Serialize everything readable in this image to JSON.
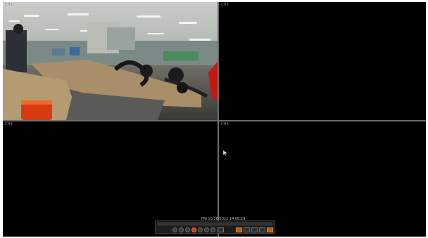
{
  "viewer": {
    "channels": [
      {
        "label": "CH1"
      },
      {
        "label": "CH2"
      },
      {
        "label": "CH3"
      },
      {
        "label": "CH4"
      }
    ],
    "timestamp": "FRI 10/26/2012 14:08:29"
  },
  "playback": {
    "progress": 0.0,
    "buttons": [
      "skip-back",
      "rewind",
      "step-back",
      "play",
      "step-forward",
      "fast-forward",
      "skip-forward",
      "layout",
      "record",
      "snapshot",
      "zoom",
      "settings",
      "close"
    ]
  },
  "colors": {
    "background": "#000000",
    "divider": "#6d6d6d",
    "play_accent": "#c83a1e"
  }
}
